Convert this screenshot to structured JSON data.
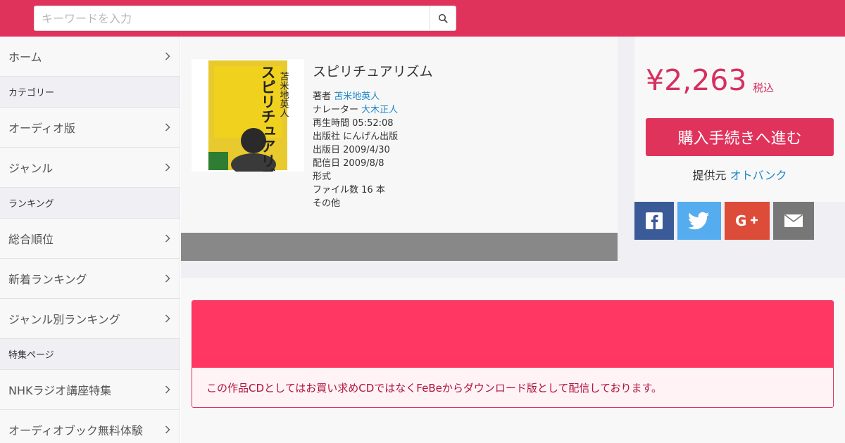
{
  "search": {
    "placeholder": "キーワードを入力",
    "button_icon": "search-icon"
  },
  "sidebar": {
    "items": [
      {
        "type": "item",
        "label": "ホーム"
      },
      {
        "type": "header",
        "label": "カテゴリー"
      },
      {
        "type": "item",
        "label": "オーディオ版"
      },
      {
        "type": "item",
        "label": "ジャンル"
      },
      {
        "type": "header",
        "label": "ランキング"
      },
      {
        "type": "item",
        "label": "総合順位"
      },
      {
        "type": "item",
        "label": "新着ランキング"
      },
      {
        "type": "item",
        "label": "ジャンル別ランキング"
      },
      {
        "type": "header",
        "label": "特集ページ"
      },
      {
        "type": "item",
        "label": "NHKラジオ講座特集"
      },
      {
        "type": "item",
        "label": "オーディオブック無料体験"
      }
    ]
  },
  "product": {
    "title": "スピリチュアリズム",
    "cover_lines": [
      "苫米地英人",
      "スピリチュアリズム"
    ],
    "meta": [
      {
        "label": "著者",
        "value": "苫米地英人",
        "link": true
      },
      {
        "label": "ナレーター",
        "value": "大木正人",
        "link": true
      },
      {
        "label": "再生時間",
        "value": "05:52:08",
        "link": false
      },
      {
        "label": "出版社",
        "value": "にんげん出版",
        "link": false
      },
      {
        "label": "出版日",
        "value": "2009/4/30",
        "link": false
      },
      {
        "label": "配信日",
        "value": "2009/8/8",
        "link": false
      },
      {
        "label": "形式",
        "value": "",
        "link": false
      },
      {
        "label": "ファイル数",
        "value": "16 本",
        "link": false
      },
      {
        "label": "その他",
        "value": "",
        "link": false
      }
    ]
  },
  "purchase": {
    "price": "¥2,263",
    "price_unit": "税込",
    "buy_label": "購入手続きへ進む",
    "provider_label": "提供元",
    "provider_value": "オトバンク"
  },
  "share": {
    "facebook_icon": "facebook-icon",
    "twitter_icon": "twitter-icon",
    "googleplus_icon": "google-plus-icon",
    "mail_icon": "mail-icon"
  },
  "notice": {
    "text": "この作品CDとしてはお買い求めCDではなくFeBeからダウンロード版として配信しております。"
  },
  "colors": {
    "header": "#e0335c",
    "accent": "#d63060",
    "link": "#1e88c8",
    "notice_head": "#ff3762"
  }
}
